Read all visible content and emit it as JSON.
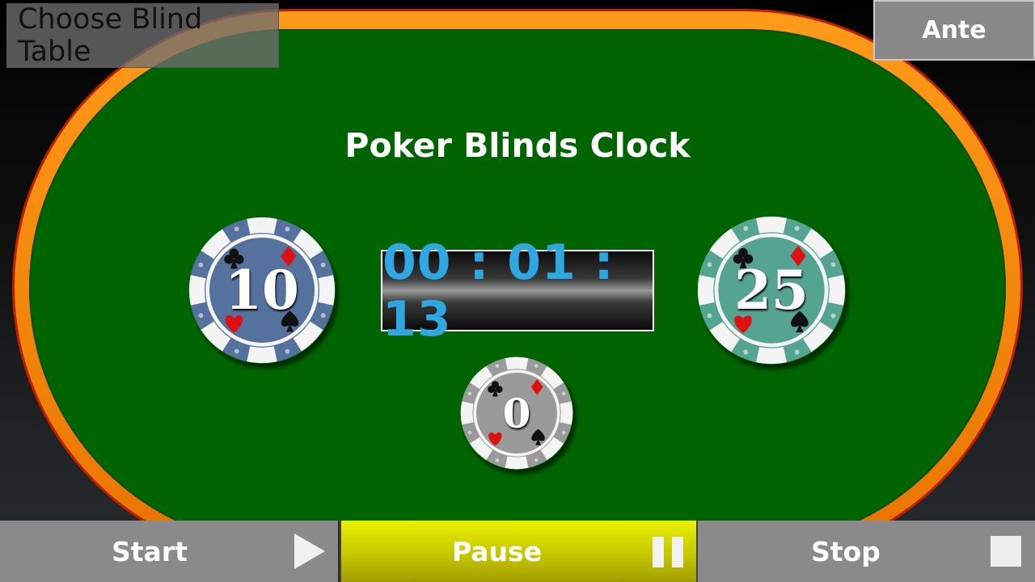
{
  "title": "Poker Blinds Clock",
  "choose_table_label": "Choose Blind Table",
  "ante_label": "Ante",
  "timer": "00 : 01 : 13",
  "small_blind": "10",
  "big_blind": "25",
  "ante_value": "0",
  "controls": {
    "start_label": "Start",
    "pause_label": "Pause",
    "stop_label": "Stop"
  },
  "colors": {
    "felt": "#006400",
    "rim": "#ff8c00",
    "timer_digits": "#2fa8e2",
    "small_chip": "#55719e",
    "big_chip": "#55a391",
    "ante_chip": "#9a9a9a",
    "pause_button": "#dbe100"
  },
  "icons": {
    "start": "play-icon",
    "pause": "pause-icon",
    "stop": "stop-icon",
    "chip_suits": [
      "club-icon",
      "diamond-icon",
      "heart-icon",
      "spade-icon"
    ]
  }
}
